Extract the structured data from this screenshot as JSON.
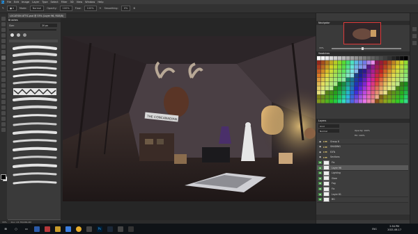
{
  "app": {
    "menu": [
      "File",
      "Edit",
      "Image",
      "Layer",
      "Type",
      "Select",
      "Filter",
      "3D",
      "View",
      "Window",
      "Help"
    ]
  },
  "options": {
    "mode_label": "Mode:",
    "mode_value": "Normal",
    "opacity_label": "Opacity:",
    "opacity_value": "100%",
    "flow_label": "Flow:",
    "flow_value": "100%",
    "smoothing_label": "Smoothing:",
    "smoothing_value": "0%"
  },
  "document": {
    "tab_title": "LOCATION ATTIC.psd @ 33% (Layer 96, RGB/8)"
  },
  "brushes_panel": {
    "title": "Brushes",
    "size_label": "Size:",
    "size_value": "20 px"
  },
  "artwork": {
    "sign_text": "THE CONCANADIAN"
  },
  "status": {
    "zoom": "33%",
    "doc_info": "Doc: 23.7M/266.4M"
  },
  "panels": {
    "navigator_title": "Navigator",
    "navigator_zoom": "33%",
    "swatches_title": "Swatches",
    "layers_title": "Layers",
    "layers_kind": "Kind",
    "layers_blend": "Normal",
    "layers_opacity": "Opacity: 100%",
    "layers_fill": "Fill: 100%",
    "layers": [
      {
        "name": "Group 8",
        "type": "folder",
        "green": false
      },
      {
        "name": "SHADING",
        "type": "folder",
        "green": false
      },
      {
        "name": "EXTs",
        "type": "folder",
        "green": false
      },
      {
        "name": "Sections",
        "type": "folder",
        "green": false
      },
      {
        "name": "Fix",
        "type": "layer",
        "green": true
      },
      {
        "name": "Layer 96",
        "type": "layer",
        "green": true,
        "selected": true
      },
      {
        "name": "Lighting",
        "type": "layer",
        "green": true
      },
      {
        "name": "Glow",
        "type": "layer",
        "green": true
      },
      {
        "name": "Fog",
        "type": "layer",
        "green": true
      },
      {
        "name": "Fix",
        "type": "layer",
        "green": true
      },
      {
        "name": "Layer 61",
        "type": "layer",
        "green": true
      },
      {
        "name": "BG",
        "type": "layer",
        "green": true
      }
    ]
  },
  "taskbar": {
    "time": "2:54 PM",
    "date": "2021-08-17",
    "tray": "ENG"
  }
}
